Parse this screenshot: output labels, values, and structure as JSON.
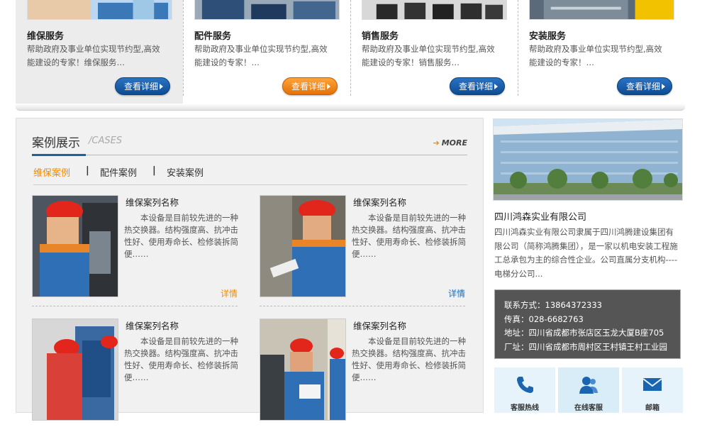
{
  "services": [
    {
      "title": "维保服务",
      "desc": "帮助政府及事业单位实现节约型,高效能建设的专家！维保服务…",
      "button": "查看详细",
      "button_style": "blue"
    },
    {
      "title": "配件服务",
      "desc": "帮助政府及事业单位实现节约型,高效能建设的专家！…",
      "button": "查看详细",
      "button_style": "orange"
    },
    {
      "title": "销售服务",
      "desc": "帮助政府及事业单位实现节约型,高效能建设的专家！销售服务…",
      "button": "查看详细",
      "button_style": "blue"
    },
    {
      "title": "安装服务",
      "desc": "帮助政府及事业单位实现节约型,高效能建设的专家！…",
      "button": "查看详细",
      "button_style": "blue"
    }
  ],
  "cases": {
    "title": "案例展示",
    "title_en": "/CASES",
    "more": "MORE",
    "tabs": [
      "维保案例",
      "配件案例",
      "安装案例"
    ],
    "separator": "|",
    "items": [
      {
        "name": "维保案列名称",
        "desc": "本设备是目前较先进的一种热交换器。结构强度高、抗冲击性好、使用寿命长、检修装拆简便……",
        "detail": "详情"
      },
      {
        "name": "维保案列名称",
        "desc": "本设备是目前较先进的一种热交换器。结构强度高、抗冲击性好、使用寿命长、检修装拆简便……",
        "detail": "详情"
      },
      {
        "name": "维保案列名称",
        "desc": "本设备是目前较先进的一种热交换器。结构强度高、抗冲击性好、使用寿命长、检修装拆简便……",
        "detail": ""
      },
      {
        "name": "维保案列名称",
        "desc": "本设备是目前较先进的一种热交换器。结构强度高、抗冲击性好、使用寿命长、检修装拆简便……",
        "detail": ""
      }
    ]
  },
  "company": {
    "name": "四川鸿森实业有限公司",
    "desc": "四川鸿森实业有限公司隶属于四川鸿腾建设集团有限公司（简称鸿腾集团），是一家以机电安装工程施工总承包为主的综合性企业。公司直属分支机构----电梯分公司...",
    "contact": {
      "phone": "联系方式：13864372333",
      "fax": "传真：028-6682763",
      "address": "地址：四川省成都市张店区玉龙大厦B座705",
      "factory": "厂址：四川省成都市周村区王村镇王村工业园"
    },
    "quick_links": [
      {
        "label": "客服热线",
        "icon": "phone-icon"
      },
      {
        "label": "在线客服",
        "icon": "customer-service-icon"
      },
      {
        "label": "邮箱",
        "icon": "mail-icon"
      }
    ]
  },
  "colors": {
    "accent_orange": "#f08c00",
    "accent_blue": "#1f5fa5",
    "contact_bg": "#555555"
  }
}
